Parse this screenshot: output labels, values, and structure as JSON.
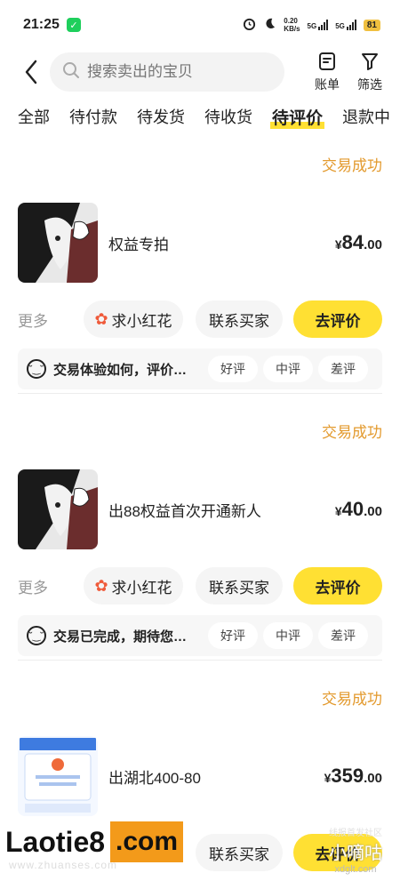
{
  "status_bar": {
    "time": "21:25",
    "net_speed": "0.20",
    "net_unit": "KB/s",
    "net1": "5G",
    "net2": "5G",
    "battery": "81"
  },
  "header": {
    "search_placeholder": "搜索卖出的宝贝",
    "bill_label": "账单",
    "filter_label": "筛选"
  },
  "tabs": [
    {
      "label": "全部"
    },
    {
      "label": "待付款"
    },
    {
      "label": "待发货"
    },
    {
      "label": "待收货"
    },
    {
      "label": "待评价",
      "active": true
    },
    {
      "label": "退款中"
    }
  ],
  "orders": [
    {
      "status": "交易成功",
      "title": "权益专拍",
      "price_currency": "¥",
      "price_int": "84",
      "price_dec": ".00",
      "more": "更多",
      "flower": "求小红花",
      "contact": "联系买家",
      "review": "去评价",
      "feedback": "交易体验如何，评价…",
      "rate_good": "好评",
      "rate_mid": "中评",
      "rate_bad": "差评"
    },
    {
      "status": "交易成功",
      "title": "出88权益首次开通新人",
      "price_currency": "¥",
      "price_int": "40",
      "price_dec": ".00",
      "more": "更多",
      "flower": "求小红花",
      "contact": "联系买家",
      "review": "去评价",
      "feedback": "交易已完成，期待您…",
      "rate_good": "好评",
      "rate_mid": "中评",
      "rate_bad": "差评"
    },
    {
      "status": "交易成功",
      "title": "出湖北400-80",
      "price_currency": "¥",
      "price_int": "359",
      "price_dec": ".00",
      "contact": "联系买家",
      "review": "去评价"
    }
  ],
  "watermark": {
    "brand_a": "Laotie8",
    "brand_b": ".com",
    "sub": "www.zhuanses.com",
    "right_top": "线报首发社区",
    "right_main": "小嘀咕",
    "right_bottom": "xdglt.com"
  },
  "colors": {
    "accent_yellow": "#ffe033",
    "status_orange": "#e39a2e"
  }
}
